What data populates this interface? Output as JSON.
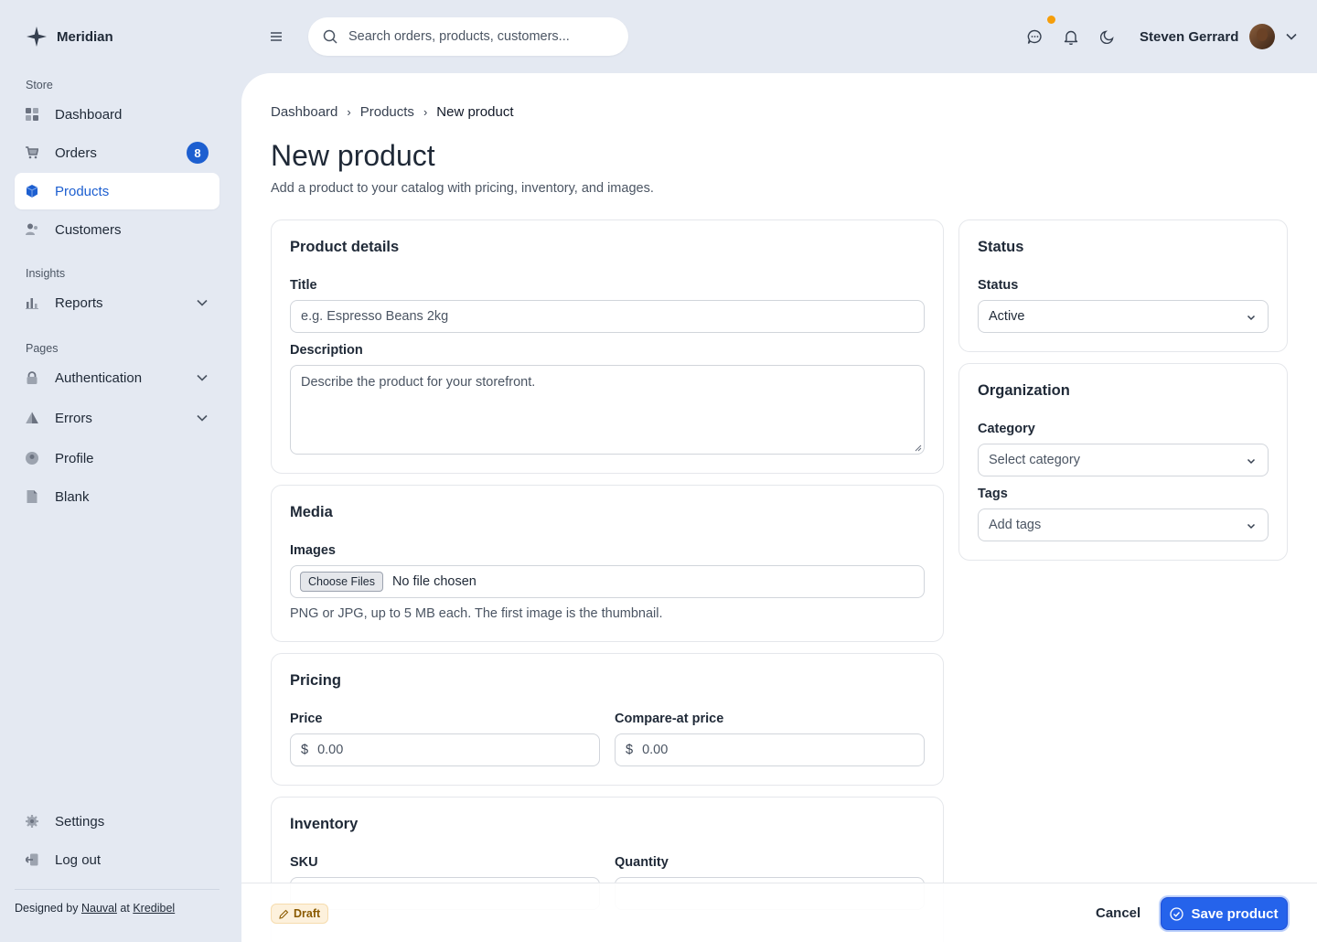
{
  "brand": {
    "name": "Meridian"
  },
  "sidebar": {
    "sections": {
      "store": "Store",
      "insights": "Insights",
      "pages": "Pages"
    },
    "items": {
      "dashboard": "Dashboard",
      "orders": "Orders",
      "orders_badge": "8",
      "products": "Products",
      "customers": "Customers",
      "reports": "Reports",
      "authentication": "Authentication",
      "errors": "Errors",
      "profile": "Profile",
      "blank": "Blank",
      "settings": "Settings",
      "logout": "Log out"
    },
    "credit": {
      "prefix": "Designed by",
      "author": "Nauval",
      "at": "at",
      "company": "Kredibel"
    }
  },
  "topbar": {
    "search_placeholder": "Search orders, products, customers...",
    "user_name": "Steven Gerrard"
  },
  "breadcrumb": [
    "Dashboard",
    "Products",
    "New product"
  ],
  "page": {
    "title": "New product",
    "subtitle": "Add a product to your catalog with pricing, inventory, and images."
  },
  "product_details": {
    "title": "Product details",
    "title_label": "Title",
    "title_placeholder": "e.g. Espresso Beans 2kg",
    "description_label": "Description",
    "description_placeholder": "Describe the product for your storefront."
  },
  "media": {
    "title": "Media",
    "images_label": "Images",
    "choose_files": "Choose Files",
    "no_file": "No file chosen",
    "help": "PNG or JPG, up to 5 MB each. The first image is the thumbnail."
  },
  "pricing": {
    "title": "Pricing",
    "price_label": "Price",
    "compare_label": "Compare-at price",
    "currency": "$",
    "price_placeholder": "0.00",
    "compare_placeholder": "0.00"
  },
  "inventory": {
    "title": "Inventory",
    "sku_label": "SKU",
    "quantity_label": "Quantity"
  },
  "status_card": {
    "title": "Status",
    "status_label": "Status",
    "status_value": "Active"
  },
  "organization": {
    "title": "Organization",
    "category_label": "Category",
    "category_placeholder": "Select category",
    "tags_label": "Tags",
    "tags_placeholder": "Add tags"
  },
  "footer": {
    "draft": "Draft",
    "cancel": "Cancel",
    "save": "Save product"
  },
  "colors": {
    "accent": "#2563eb",
    "sidebar_bg": "#e4e9f2",
    "notification_dot": "#f59e0b",
    "draft_badge_bg": "#fdf1dc"
  }
}
